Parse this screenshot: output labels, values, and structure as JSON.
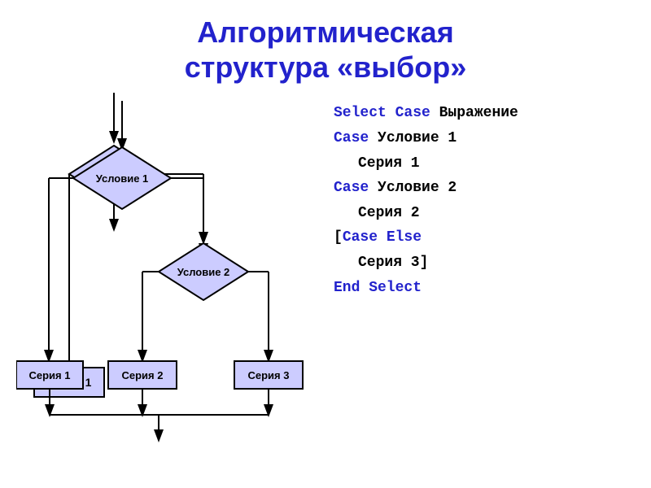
{
  "title": {
    "line1": "Алгоритмическая",
    "line2": "структура «выбор»"
  },
  "flowchart": {
    "diamond1_label": "Условие 1",
    "diamond2_label": "Условие 2",
    "box1_label": "Серия 1",
    "box2_label": "Серия 2",
    "box3_label": "Серия 3"
  },
  "code": {
    "line1_kw": "Select Case",
    "line1_rest": " Выражение",
    "line2_kw": "Case",
    "line2_rest": " Условие 1",
    "line3": "Серия 1",
    "line4_kw": "Case",
    "line4_rest": " Условие 2",
    "line5": "Серия 2",
    "line6_bracket": "[",
    "line6_kw": "Case Else",
    "line7": "Серия 3]",
    "line8_kw": "End Select"
  }
}
